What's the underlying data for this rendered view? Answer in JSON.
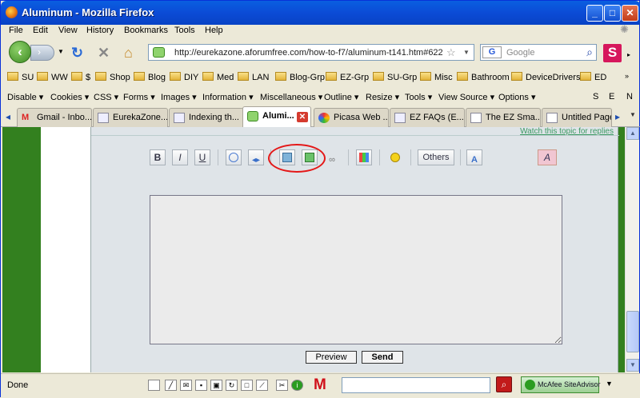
{
  "window": {
    "title": "Aluminum - Mozilla Firefox"
  },
  "menu": [
    "File",
    "Edit",
    "View",
    "History",
    "Bookmarks",
    "Tools",
    "Help"
  ],
  "nav": {
    "url": "http://eurekazone.aforumfree.com/how-to-f7/aluminum-t141.htm#622",
    "search_placeholder": "Google",
    "search_engine_label": "G"
  },
  "bookmarks": [
    "SU",
    "WW",
    "$",
    "Shop",
    "Blog",
    "DIY",
    "Med",
    "LAN",
    "Blog-Grp",
    "EZ-Grp",
    "SU-Grp",
    "Misc",
    "Bathroom",
    "DeviceDrivers",
    "ED"
  ],
  "webdev": [
    "Disable",
    "Cookies",
    "CSS",
    "Forms",
    "Images",
    "Information",
    "Miscellaneous",
    "Outline",
    "Resize",
    "Tools",
    "View Source",
    "Options"
  ],
  "webdev_right": [
    "S",
    "E",
    "N"
  ],
  "tabs": [
    {
      "label": "Gmail - Inbo...",
      "icon": "gmail-icon"
    },
    {
      "label": "EurekaZone...",
      "icon": "page-icon"
    },
    {
      "label": "Indexing th...",
      "icon": "page-icon"
    },
    {
      "label": "Alumi...",
      "icon": "speech-icon"
    },
    {
      "label": "Picasa Web ...",
      "icon": "picasa-icon"
    },
    {
      "label": "EZ FAQs (E...",
      "icon": "page-icon"
    },
    {
      "label": "The EZ Sma...",
      "icon": "page-icon"
    },
    {
      "label": "Untitled Page",
      "icon": "page-icon"
    }
  ],
  "page": {
    "watch_link": "Watch this topic for replies",
    "toolbar": {
      "bold": "B",
      "italic": "I",
      "underline": "U",
      "others": "Others",
      "font_size": "A"
    },
    "preview_label": "Preview",
    "send_label": "Send"
  },
  "status": {
    "text": "Done",
    "siteadvisor": "McAfee SiteAdvisor"
  }
}
